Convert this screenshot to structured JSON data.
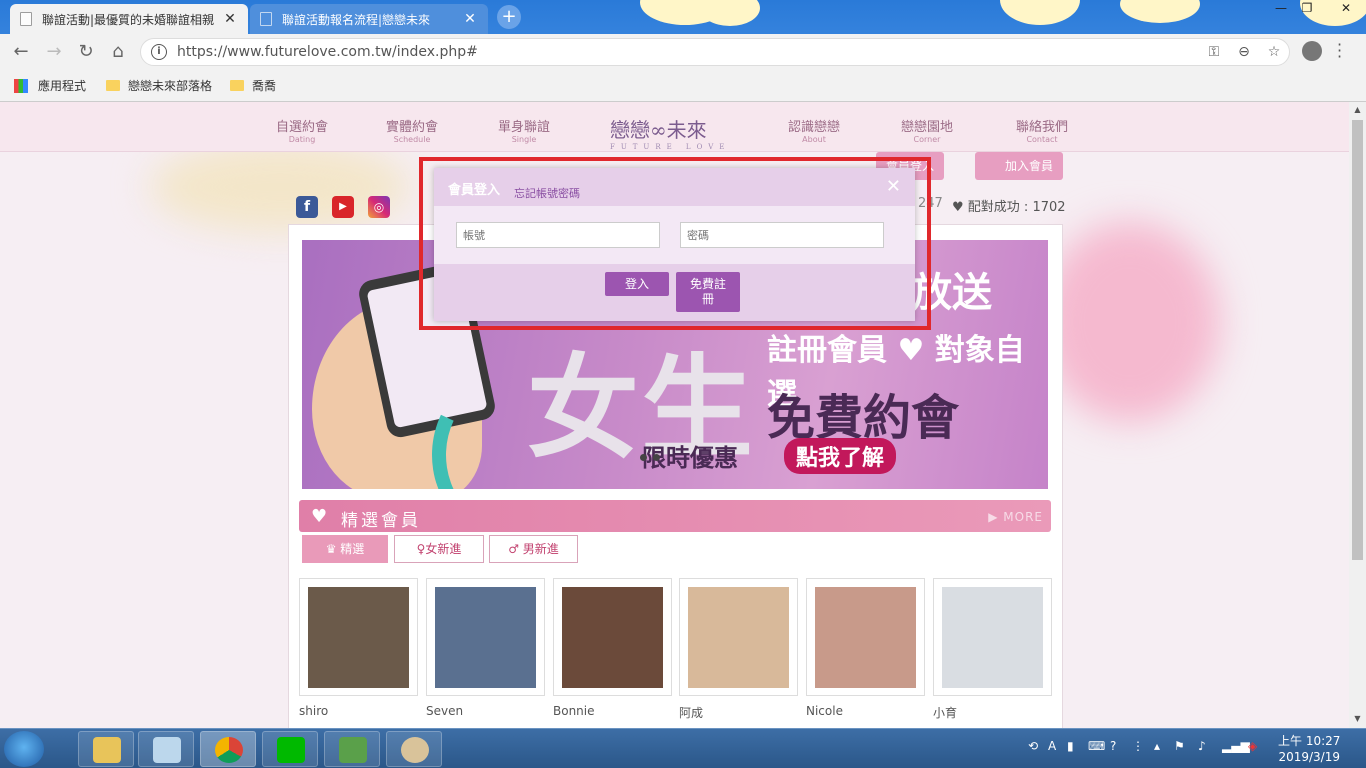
{
  "browser": {
    "tabs": [
      {
        "title": "聯誼活動|最優質的未婚聯誼相親",
        "close": "✕"
      },
      {
        "title": "聯誼活動報名流程|戀戀未來",
        "close": "✕"
      }
    ],
    "new_tab": "+",
    "window_controls": [
      "—",
      "❐",
      "✕"
    ],
    "nav": {
      "back": "←",
      "forward": "→",
      "reload": "↻",
      "home": "⌂"
    },
    "url": "https://www.futurelove.com.tw/index.php#",
    "omnibox_icons": {
      "key": "⚿",
      "zoom": "⊖",
      "star": "☆"
    },
    "bookmarks": [
      "應用程式",
      "戀戀未來部落格",
      "喬喬"
    ]
  },
  "site": {
    "nav": [
      {
        "zh": "自選約會",
        "en": "Dating"
      },
      {
        "zh": "實體約會",
        "en": "Schedule"
      },
      {
        "zh": "單身聯誼",
        "en": "Single"
      },
      {
        "zh": "認識戀戀",
        "en": "About"
      },
      {
        "zh": "戀戀園地",
        "en": "Corner"
      },
      {
        "zh": "聯絡我們",
        "en": "Contact"
      }
    ],
    "logo": "戀戀∞未來",
    "logo_sub": "FUTURE LOVE",
    "member_login": "會員登入",
    "join_member": "加入會員",
    "stat_partial": "247",
    "match_success": "配對成功 : 1702",
    "banner": {
      "top": "放送",
      "line1": "註冊會員 ♥ 對象自選",
      "big": "女生",
      "line2": "免費約會",
      "promo": "限時優惠",
      "cta": "點我了解"
    },
    "featured": {
      "title": "精選會員",
      "more": "MORE",
      "filters": [
        "精選",
        "女新進",
        "男新進"
      ]
    },
    "members": [
      {
        "name": "shiro",
        "photo": "#6b5a4a"
      },
      {
        "name": "Seven",
        "photo": "#5a7090"
      },
      {
        "name": "Bonnie",
        "photo": "#6b4a3a"
      },
      {
        "name": "阿成",
        "photo": "#d8b99a"
      },
      {
        "name": "Nicole",
        "photo": "#c89a8a"
      },
      {
        "name": "小育",
        "photo": "#d9dde2"
      }
    ]
  },
  "login_modal": {
    "title": "會員登入",
    "forgot": "忘記帳號密碼",
    "close": "✕",
    "account_placeholder": "帳號",
    "password_placeholder": "密碼",
    "login_button": "登入",
    "register_button": "免費註冊"
  },
  "taskbar": {
    "clock_time": "上午 10:27",
    "clock_date": "2019/3/19"
  }
}
